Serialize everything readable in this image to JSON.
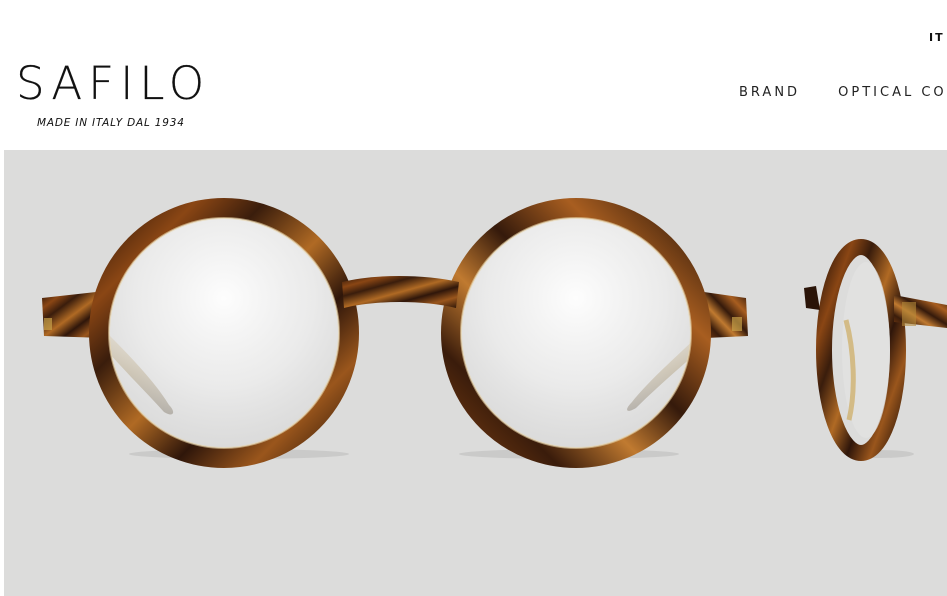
{
  "header": {
    "language": "IT",
    "logo": {
      "wordmark": "SAFILO",
      "tagline": "MADE IN ITALY DAL 1934"
    },
    "nav": {
      "items": [
        {
          "label": "BRAND"
        },
        {
          "label": "OPTICAL COLLE"
        }
      ]
    }
  },
  "hero": {
    "image": "tortoiseshell-round-eyeglasses",
    "colors": {
      "background": "#dcdcdb",
      "frame_dark": "#3a1d0c",
      "frame_mid": "#7a3e12",
      "frame_light": "#c88a3a"
    }
  }
}
